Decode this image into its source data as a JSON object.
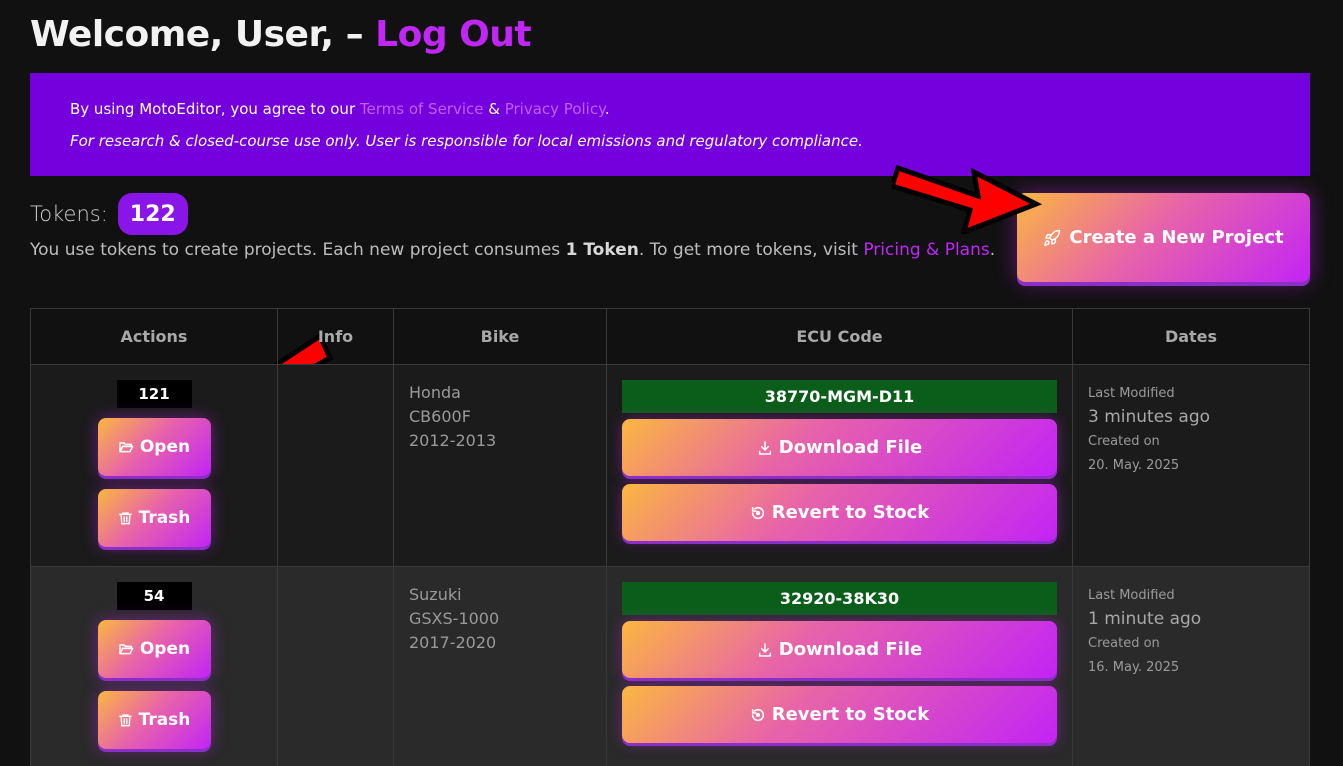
{
  "header": {
    "welcome": "Welcome, User, – ",
    "logout": "Log Out"
  },
  "notice": {
    "line1_prefix": "By using MotoEditor, you agree to our ",
    "terms": "Terms of Service",
    "amp": " & ",
    "privacy": "Privacy Policy",
    "line1_suffix": ".",
    "line2": "For research & closed-course use only. User is responsible for local emissions and regulatory compliance."
  },
  "tokens": {
    "label": "Tokens:",
    "count": "122",
    "help_prefix": "You use tokens to create projects. Each new project consumes ",
    "help_bold": "1 Token",
    "help_middle": ". To get more tokens, visit ",
    "help_link": "Pricing & Plans",
    "help_suffix": "."
  },
  "create_button": {
    "label": "Create a New Project",
    "icon": "rocket-icon"
  },
  "table": {
    "headers": [
      "Actions",
      "Info",
      "Bike",
      "ECU Code",
      "Dates"
    ],
    "rows": [
      {
        "id": "121",
        "open_label": "Open",
        "trash_label": "Trash",
        "bike_make": "Honda",
        "bike_model": "CB600F",
        "bike_years": "2012-2013",
        "ecu_code": "38770-MGM-D11",
        "download_label": "Download File",
        "revert_label": "Revert to Stock",
        "last_modified_label": "Last Modified",
        "last_modified": "3 minutes ago",
        "created_label": "Created on",
        "created": "20. May. 2025"
      },
      {
        "id": "54",
        "open_label": "Open",
        "trash_label": "Trash",
        "bike_make": "Suzuki",
        "bike_model": "GSXS-1000",
        "bike_years": "2017-2020",
        "ecu_code": "32920-38K30",
        "download_label": "Download File",
        "revert_label": "Revert to Stock",
        "last_modified_label": "Last Modified",
        "last_modified": "1 minute ago",
        "created_label": "Created on",
        "created": "16. May. 2025"
      }
    ]
  },
  "colors": {
    "background": "#111111",
    "accent_purple": "#c026f5",
    "banner": "#7400dd",
    "ecu_green": "#0b5e1a",
    "arrow_red": "#ff0000"
  }
}
